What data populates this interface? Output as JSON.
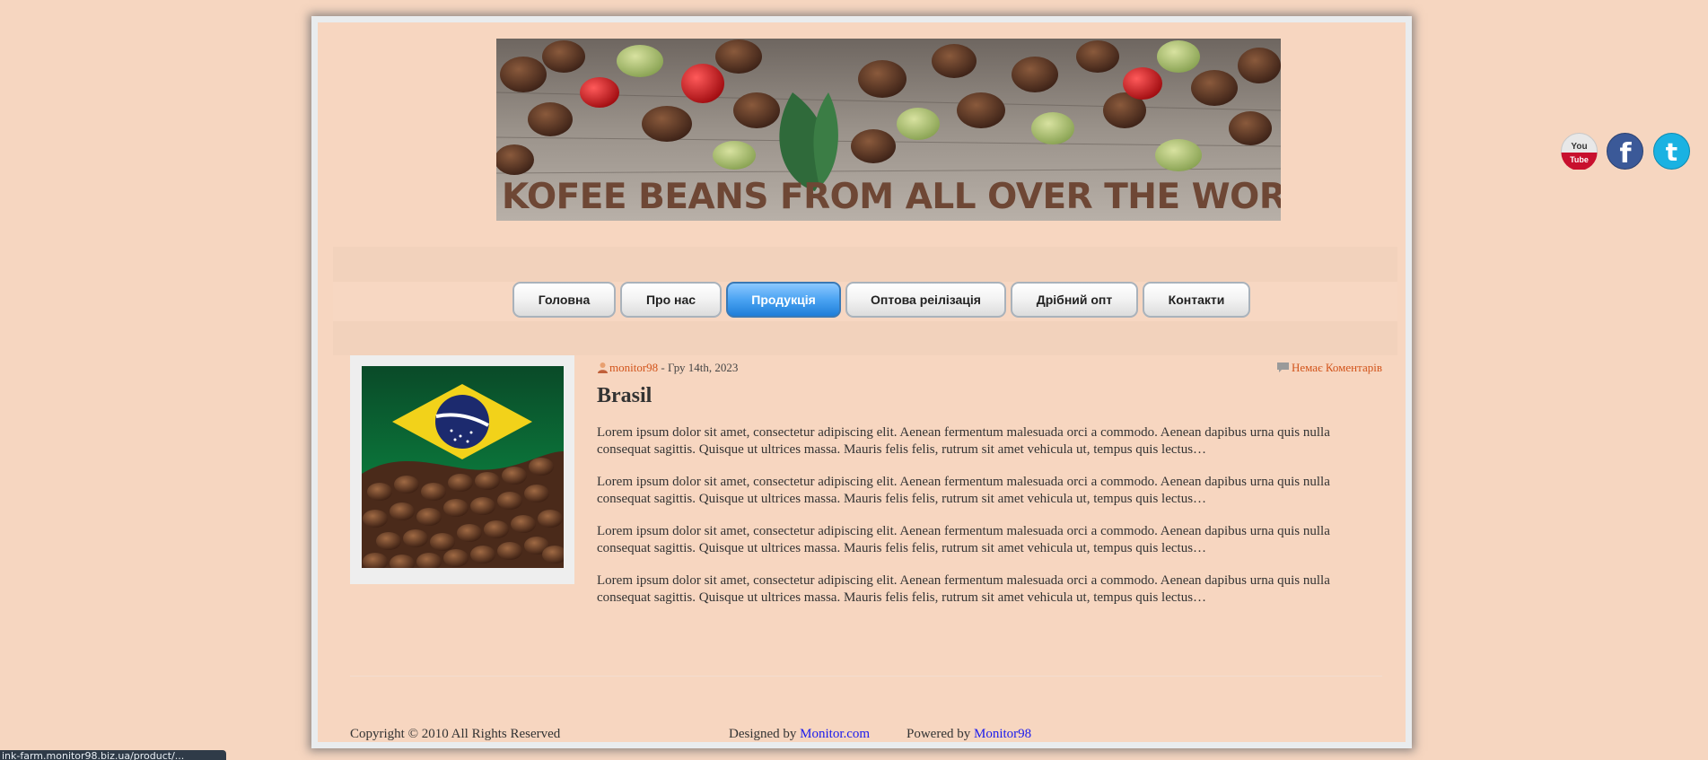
{
  "banner": {
    "title": "KOFEE BEANS FROM ALL OVER THE WORLD"
  },
  "nav": {
    "items": [
      {
        "label": "Головна",
        "active": false
      },
      {
        "label": "Про нас",
        "active": false
      },
      {
        "label": "Продукція",
        "active": true
      },
      {
        "label": "Оптова реілізація",
        "active": false
      },
      {
        "label": "Дрібний опт",
        "active": false
      },
      {
        "label": "Контакти",
        "active": false
      }
    ]
  },
  "post": {
    "author": "monitor98",
    "date": "- Гру 14th, 2023",
    "comments": "Немає Коментарів",
    "title": "Brasil",
    "paragraphs": [
      "Lorem ipsum dolor sit amet, consectetur adipiscing elit. Aenean fermentum malesuada orci a commodo. Aenean dapibus urna quis nulla consequat sagittis. Quisque ut ultrices massa. Mauris felis felis, rutrum sit amet vehicula ut, tempus quis lectus…",
      "Lorem ipsum dolor sit amet, consectetur adipiscing elit. Aenean fermentum malesuada orci a commodo. Aenean dapibus urna quis nulla consequat sagittis. Quisque ut ultrices massa. Mauris felis felis, rutrum sit amet vehicula ut, tempus quis lectus…",
      "Lorem ipsum dolor sit amet, consectetur adipiscing elit. Aenean fermentum malesuada orci a commodo. Aenean dapibus urna quis nulla consequat sagittis. Quisque ut ultrices massa. Mauris felis felis, rutrum sit amet vehicula ut, tempus quis lectus…",
      "Lorem ipsum dolor sit amet, consectetur adipiscing elit. Aenean fermentum malesuada orci a commodo. Aenean dapibus urna quis nulla consequat sagittis. Quisque ut ultrices massa. Mauris felis felis, rutrum sit amet vehicula ut, tempus quis lectus…"
    ]
  },
  "footer": {
    "copyright": "Copyright © 2010 All Rights Reserved",
    "designed_prefix": "Designed by",
    "designed_link": "Monitor.com",
    "powered_prefix": "Powered by",
    "powered_link": "Monitor98"
  },
  "social": [
    {
      "name": "youtube-icon",
      "top_text": "You",
      "bottom_text": "Tube"
    },
    {
      "name": "facebook-icon",
      "text": "f"
    },
    {
      "name": "twitter-icon",
      "text": "t"
    }
  ],
  "status_bar": {
    "text": "ink-farm.monitor98.biz.ua/product/..."
  },
  "colors": {
    "page_bg": "#f6d6c0",
    "link_orange": "#d2541b",
    "link_blue": "#1a1aee",
    "nav_active": "#2f8ae6"
  }
}
